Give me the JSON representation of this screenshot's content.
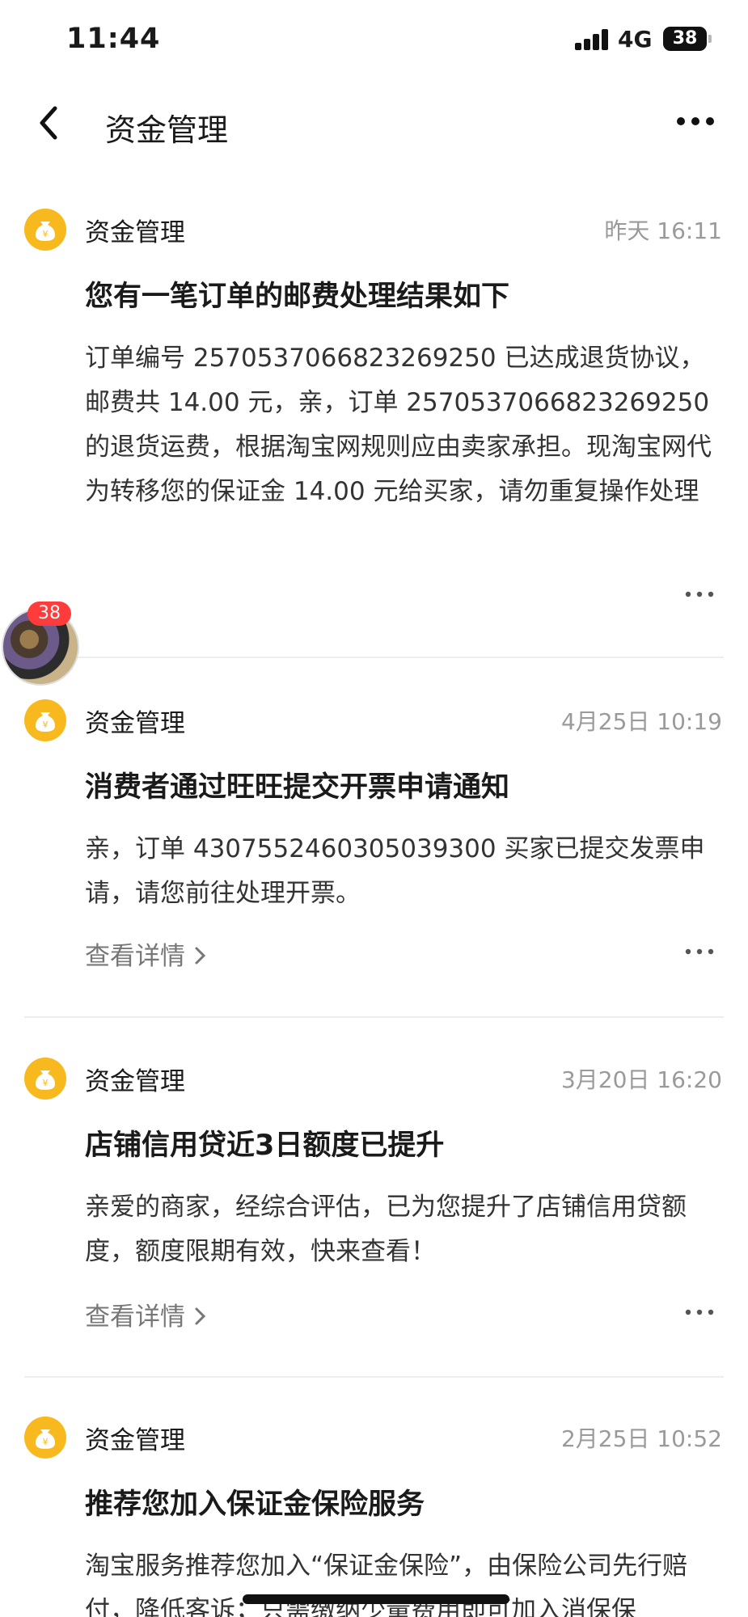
{
  "status_bar": {
    "time": "11:44",
    "network": "4G",
    "battery": "38"
  },
  "nav": {
    "title": "资金管理"
  },
  "messages": [
    {
      "sender": "资金管理",
      "time": "昨天 16:11",
      "title": "您有一笔订单的邮费处理结果如下",
      "body": "订单编号 2570537066823269250 已达成退货协议，邮费共 14.00 元，亲，订单 2570537066823269250 的退货运费，根据淘宝网规则应由卖家承担。现淘宝网代为转移您的保证金 14.00 元给买家，请勿重复操作处理运费哦。，您后续无需重复处理邮费退款，请知悉"
    },
    {
      "sender": "资金管理",
      "time": "4月25日 10:19",
      "title": "消费者通过旺旺提交开票申请通知",
      "body": "亲，订单 4307552460305039300 买家已提交发票申请，请您前往处理开票。",
      "link": "查看详情"
    },
    {
      "sender": "资金管理",
      "time": "3月20日 16:20",
      "title": "店铺信用贷近3日额度已提升",
      "body": "亲爱的商家，经综合评估，已为您提升了店铺信用贷额度，额度限期有效，快来查看！",
      "link": "查看详情"
    },
    {
      "sender": "资金管理",
      "time": "2月25日 10:52",
      "title": "推荐您加入保证金保险服务",
      "body": "淘宝服务推荐您加入“保证金保险”，由保险公司先行赔付，降低客诉；只需缴纳少量费用即可加入消保保"
    }
  ],
  "floating_avatar": {
    "badge": "38"
  },
  "icons": {
    "back": "chevron-left-icon",
    "more": "more-horizontal-icon",
    "sender": "money-bag-icon",
    "link_arrow": "chevron-right-icon"
  },
  "colors": {
    "sender_icon": "#f7b91e",
    "badge": "#ff3b3b",
    "muted_text": "#9a9a9a"
  }
}
